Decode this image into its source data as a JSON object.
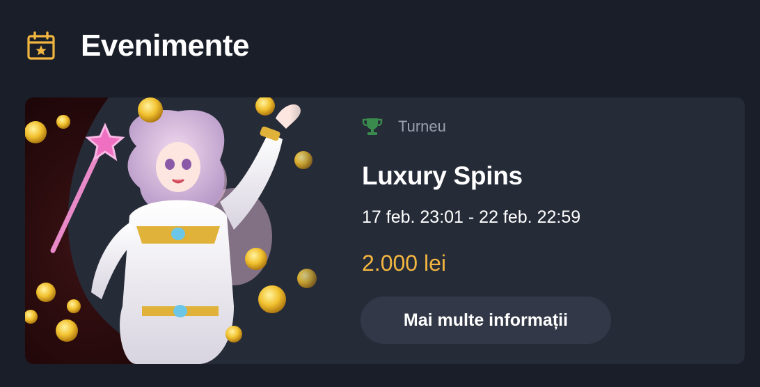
{
  "header": {
    "title": "Evenimente",
    "icon": "calendar-star-icon",
    "icon_color": "#f2b640"
  },
  "event": {
    "type_icon": "trophy-icon",
    "type_icon_color": "#3a8a4e",
    "type_label": "Turneu",
    "name": "Luxury Spins",
    "dates": "17 feb. 23:01 - 22 feb. 22:59",
    "prize": "2.000 lei",
    "prize_color": "#f2b640",
    "button_label": "Mai multe informații"
  },
  "colors": {
    "background": "#1a1e28",
    "card": "#262b38",
    "button": "#323847"
  }
}
